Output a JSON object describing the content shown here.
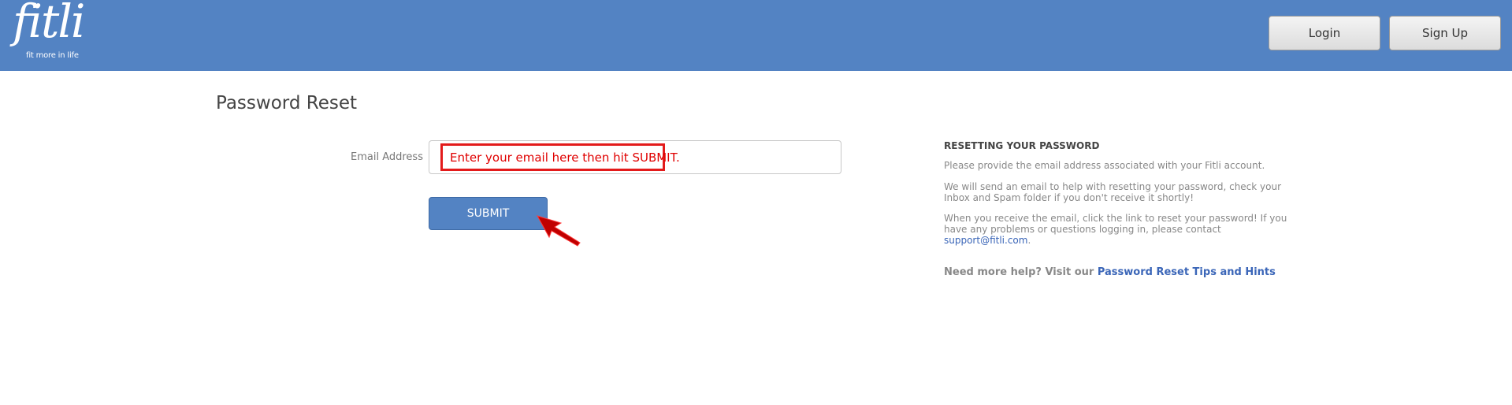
{
  "header": {
    "logo_word": "fitli",
    "logo_tagline": "fit more in life",
    "login_label": "Login",
    "signup_label": "Sign Up"
  },
  "main": {
    "title": "Password Reset",
    "email_label": "Email Address",
    "email_value": "",
    "annotation_text": "Enter your email here then hit SUBMIT.",
    "submit_label": "SUBMIT"
  },
  "sidebar": {
    "heading": "RESETTING YOUR PASSWORD",
    "p1": "Please provide the email address associated with your Fitli account.",
    "p2": "We will send an email to help with resetting your password, check your Inbox and Spam folder if you don't receive it shortly!",
    "p3_text": "When you receive the email, click the link to reset your password!  If you have any problems or questions logging in, please contact ",
    "p3_link": "support@fitli.com",
    "p3_end": ".",
    "help_text": "Need more help?  Visit our ",
    "help_link": "Password Reset Tips and Hints"
  },
  "colors": {
    "brand_blue": "#5383c3",
    "annotation_red": "#e31b1b",
    "link_blue": "#3b66b8"
  }
}
